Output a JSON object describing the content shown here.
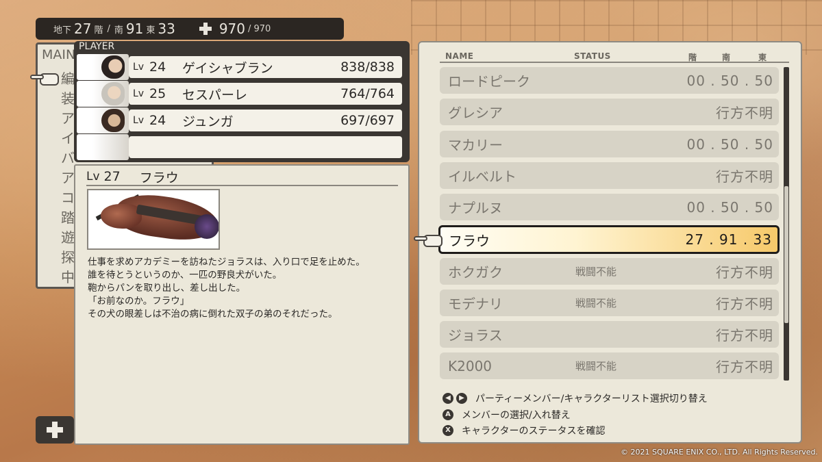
{
  "topbar": {
    "floor_label": "地下",
    "floor_value": "27",
    "floor_unit": "階",
    "sep": "/",
    "south_label": "南",
    "south_value": "91",
    "east_label": "東",
    "east_value": "33",
    "hp_current": "970",
    "hp_max": "/ 970"
  },
  "main_menu": {
    "header": "MAIN",
    "items": [
      "編",
      "装",
      "ア",
      "イ",
      "バ",
      "ア",
      "コ",
      "踏",
      "遊",
      "探",
      "中"
    ]
  },
  "party": {
    "label": "PLAYER",
    "lv_label": "Lv",
    "members": [
      {
        "level": "24",
        "name": "ゲイシャブラン",
        "hp": "838/838"
      },
      {
        "level": "25",
        "name": "セスパーレ",
        "hp": "764/764"
      },
      {
        "level": "24",
        "name": "ジュンガ",
        "hp": "697/697"
      },
      {
        "level": "",
        "name": "",
        "hp": ""
      }
    ]
  },
  "detail": {
    "lv_label": "Lv",
    "level": "27",
    "name": "フラウ",
    "description": [
      "仕事を求めアカデミーを訪ねたジョラスは、入り口で足を止めた。",
      "誰を待とうというのか、一匹の野良犬がいた。",
      "鞄からパンを取り出し、差し出した。",
      "「お前なのか。フラウ」",
      "その犬の眼差しは不治の病に倒れた双子の弟のそれだった。"
    ]
  },
  "list": {
    "headers": {
      "name": "NAME",
      "status": "STATUS",
      "floor": "階",
      "south": "南",
      "east": "東"
    },
    "rows": [
      {
        "name": "ロードピーク",
        "status": "",
        "location": "00 . 50 . 50"
      },
      {
        "name": "グレシア",
        "status": "",
        "location": "行方不明"
      },
      {
        "name": "マカリー",
        "status": "",
        "location": "00 . 50 . 50"
      },
      {
        "name": "イルベルト",
        "status": "",
        "location": "行方不明"
      },
      {
        "name": "ナプルヌ",
        "status": "",
        "location": "00 . 50 . 50"
      },
      {
        "name": "フラウ",
        "status": "",
        "location": "27 . 91 . 33"
      },
      {
        "name": "ホクガク",
        "status": "戦闘不能",
        "location": "行方不明"
      },
      {
        "name": "モデナリ",
        "status": "戦闘不能",
        "location": "行方不明"
      },
      {
        "name": "ジョラス",
        "status": "",
        "location": "行方不明"
      },
      {
        "name": "K2000",
        "status": "戦闘不能",
        "location": "行方不明"
      }
    ],
    "selected_index": 5,
    "scroll_position": 0.4
  },
  "legend": {
    "items": [
      {
        "buttons": [
          "◀",
          "▶"
        ],
        "text": "パーティーメンバー/キャラクターリスト選択切り替え"
      },
      {
        "buttons": [
          "A"
        ],
        "text": "メンバーの選択/入れ替え"
      },
      {
        "buttons": [
          "X"
        ],
        "text": "キャラクターのステータスを確認"
      }
    ]
  },
  "copyright": "© 2021 SQUARE ENIX CO., LTD. All Rights Reserved."
}
